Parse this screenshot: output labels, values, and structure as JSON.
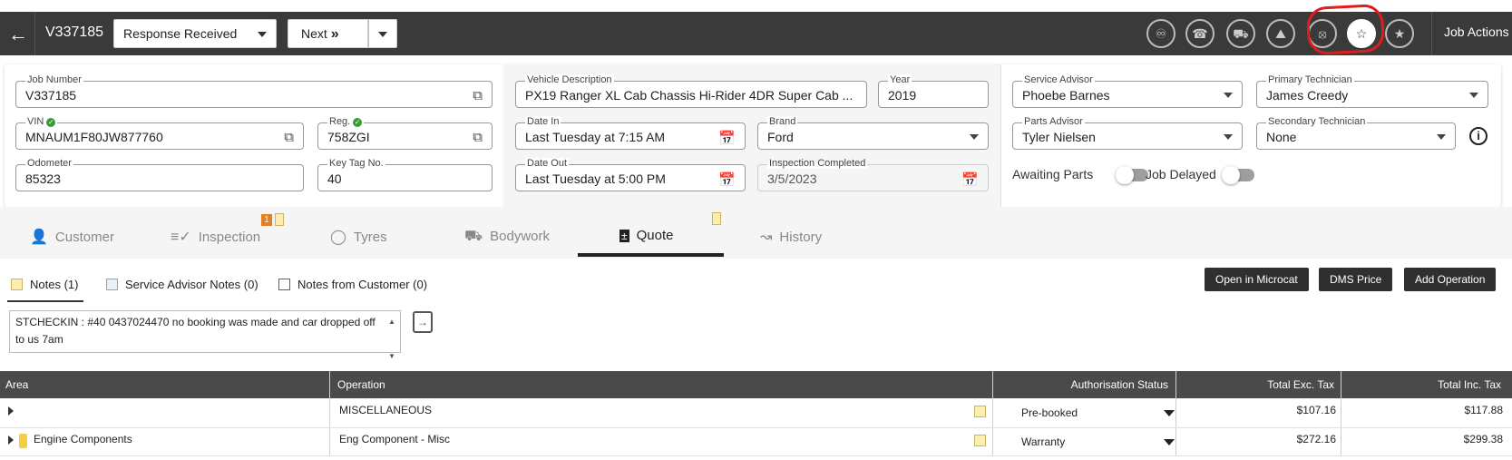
{
  "header": {
    "job_id": "V337185",
    "status": "Response Received",
    "next_label": "Next",
    "job_actions": "Job Actions",
    "icons": [
      "waiting-customer-icon",
      "phone-icon",
      "tow-truck-icon",
      "car-wash-icon",
      "no-phone-icon",
      "star-icon",
      "award-icon"
    ]
  },
  "details": {
    "job_number": {
      "label": "Job Number",
      "value": "V337185"
    },
    "vin": {
      "label": "VIN",
      "value": "MNAUM1F80JW877760"
    },
    "reg": {
      "label": "Reg.",
      "value": "758ZGI"
    },
    "odometer": {
      "label": "Odometer",
      "value": "85323"
    },
    "key_tag": {
      "label": "Key Tag No.",
      "value": "40"
    },
    "vehicle_description": {
      "label": "Vehicle Description",
      "value": "PX19 Ranger XL Cab Chassis Hi-Rider 4DR Super Cab ..."
    },
    "year": {
      "label": "Year",
      "value": "2019"
    },
    "date_in": {
      "label": "Date In",
      "value": "Last Tuesday at 7:15 AM"
    },
    "brand": {
      "label": "Brand",
      "value": "Ford"
    },
    "date_out": {
      "label": "Date Out",
      "value": "Last Tuesday at 5:00 PM"
    },
    "inspection_completed": {
      "label": "Inspection Completed",
      "value": "3/5/2023"
    },
    "service_advisor": {
      "label": "Service Advisor",
      "value": "Phoebe Barnes"
    },
    "primary_technician": {
      "label": "Primary Technician",
      "value": "James Creedy"
    },
    "parts_advisor": {
      "label": "Parts Advisor",
      "value": "Tyler Nielsen"
    },
    "secondary_technician": {
      "label": "Secondary Technician",
      "value": "None"
    },
    "awaiting_parts": "Awaiting Parts",
    "job_delayed": "Job Delayed"
  },
  "tabs": [
    {
      "label": "Customer",
      "icon": "person-icon"
    },
    {
      "label": "Inspection",
      "icon": "checklist-icon",
      "badge": "1"
    },
    {
      "label": "Tyres",
      "icon": "tyre-icon"
    },
    {
      "label": "Bodywork",
      "icon": "car-icon"
    },
    {
      "label": "Quote",
      "icon": "calculator-icon",
      "active": true
    },
    {
      "label": "History",
      "icon": "chart-line-icon"
    }
  ],
  "notes": {
    "tabs": [
      "Notes (1)",
      "Service Advisor Notes (0)",
      "Notes from Customer (0)"
    ],
    "text": "STCHECKIN : #40 0437024470 no booking was made and car dropped off to us 7am"
  },
  "actions": [
    "Open in Microcat",
    "DMS Price",
    "Add Operation"
  ],
  "table": {
    "columns": [
      "Area",
      "Operation",
      "Authorisation Status",
      "Total Exc. Tax",
      "Total Inc. Tax"
    ],
    "rows": [
      {
        "area": "",
        "operation": "MISCELLANEOUS",
        "status": "Pre-booked",
        "exc": "$107.16",
        "inc": "$117.88"
      },
      {
        "area": "Engine Components",
        "operation": "Eng Component - Misc",
        "status": "Warranty",
        "exc": "$272.16",
        "inc": "$299.38"
      }
    ]
  },
  "colors": {
    "dark_bar": "#3a3a3a",
    "annotation_ring": "#e01c1c",
    "toggle_off": "#9e9e9e",
    "note_yellow": "#fbeeb0"
  }
}
